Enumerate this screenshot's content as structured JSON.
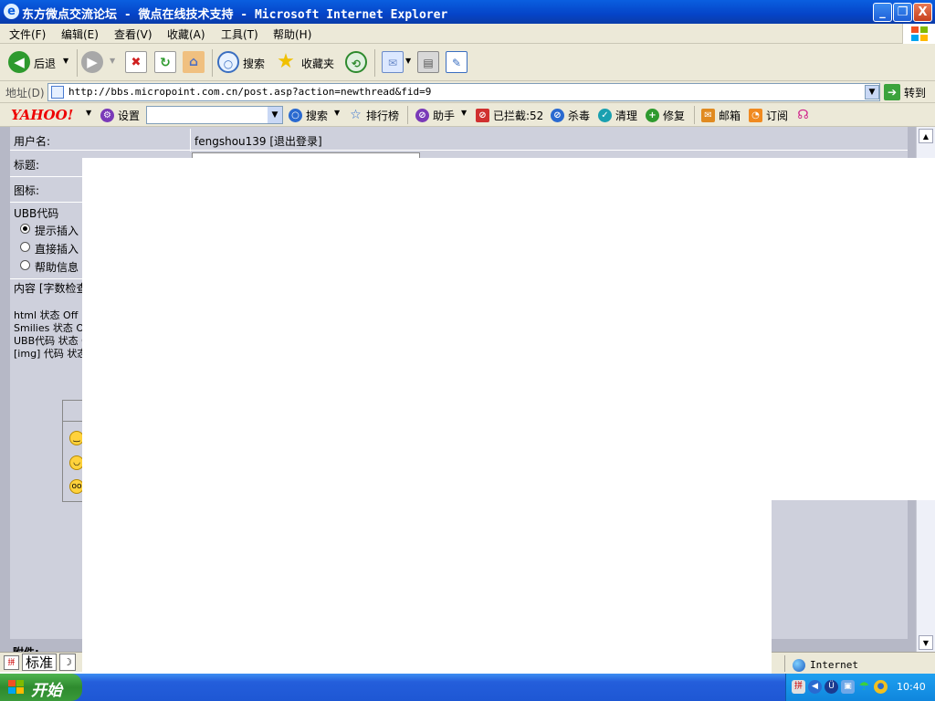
{
  "window": {
    "title": "东方微点交流论坛 - 微点在线技术支持 - Microsoft Internet Explorer",
    "min_glyph": "_",
    "max_glyph": "❐",
    "close_glyph": "X"
  },
  "menu": [
    "文件(F)",
    "编辑(E)",
    "查看(V)",
    "收藏(A)",
    "工具(T)",
    "帮助(H)"
  ],
  "toolbar": {
    "back": "后退",
    "search": "搜索",
    "favorites": "收藏夹"
  },
  "address": {
    "label": "地址(D)",
    "url": "http://bbs.micropoint.com.cn/post.asp?action=newthread&fid=9",
    "go": "转到"
  },
  "yahoo": {
    "logo": "YAHOO!",
    "settings": "设置",
    "search": "搜索",
    "ranking": "排行榜",
    "assistant": "助手",
    "blocked": "已拦截:52",
    "antivirus": "杀毒",
    "clean": "清理",
    "repair": "修复",
    "mail": "邮箱",
    "subscribe": "订阅"
  },
  "form": {
    "username_label": "用户名:",
    "username_value": "fengshou139 [退出登录]",
    "title_label": "标题:",
    "icon_label": "图标:",
    "ubb_label": "UBB代码",
    "ubb_options": [
      "提示插入",
      "直接插入",
      "帮助信息"
    ],
    "content_label": "内容 [字数检查",
    "status_lines": [
      "html 状态 Off",
      "Smilies 状态 On",
      "UBB代码 状态 O",
      "[img] 代码 状态"
    ],
    "attach_label": "附件:"
  },
  "ime": {
    "mode": "标准"
  },
  "status": {
    "zone": "Internet"
  },
  "taskbar": {
    "start": "开始",
    "clock": "10:40"
  },
  "colors": {
    "title_bar": "#0a5fe0",
    "page_bg": "#ced0dc",
    "taskbar": "#245edb",
    "start_button": "#3a9a3a"
  }
}
